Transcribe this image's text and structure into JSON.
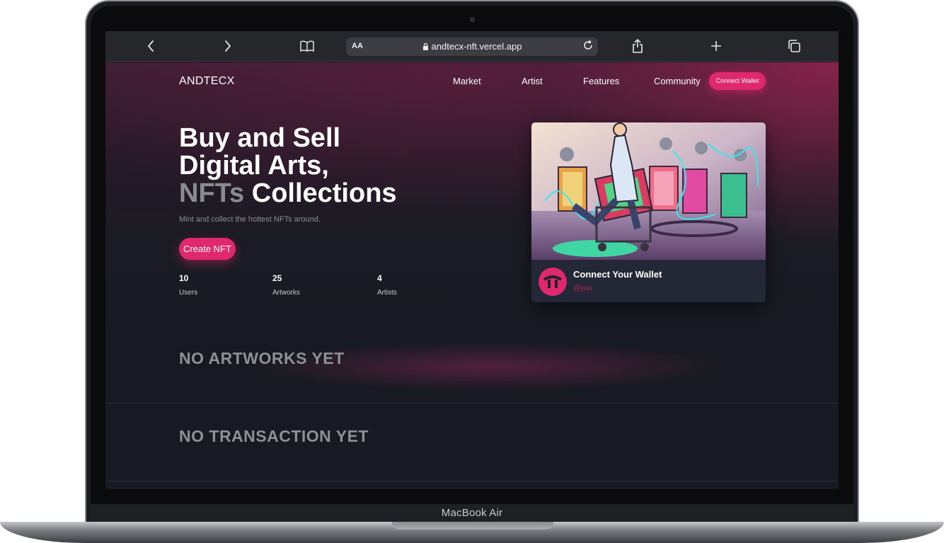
{
  "device": {
    "label": "MacBook Air"
  },
  "browser": {
    "back_icon": "chevron-left-icon",
    "forward_icon": "chevron-right-icon",
    "bookmarks_icon": "book-icon",
    "text_size": "AA",
    "url": "andtecx-nft.vercel.app",
    "lock_icon": "lock-icon",
    "reload_icon": "reload-icon",
    "share_icon": "share-icon",
    "new_tab_icon": "plus-icon",
    "tabs_icon": "tabs-icon"
  },
  "site": {
    "brand": "ANDTECX",
    "nav": [
      "Market",
      "Artist",
      "Features",
      "Community"
    ],
    "connect_label": "Connect Wallet",
    "accent": "#e0286f"
  },
  "hero": {
    "line1": "Buy and Sell",
    "line2": "Digital Arts,",
    "line3_muted": "NFTs",
    "line3_rest": " Collections",
    "subtitle": "Mint and collect the hottest NFTs around.",
    "cta": "Create NFT",
    "stats": [
      {
        "value": "10",
        "label": "Users"
      },
      {
        "value": "25",
        "label": "Artworks"
      },
      {
        "value": "4",
        "label": "Artists"
      }
    ]
  },
  "card": {
    "title": "Connect Your Wallet",
    "handle": "@you"
  },
  "sections": {
    "artworks_empty": "NO ARTWORKS YET",
    "transactions_empty": "NO TRANSACTION YET"
  }
}
